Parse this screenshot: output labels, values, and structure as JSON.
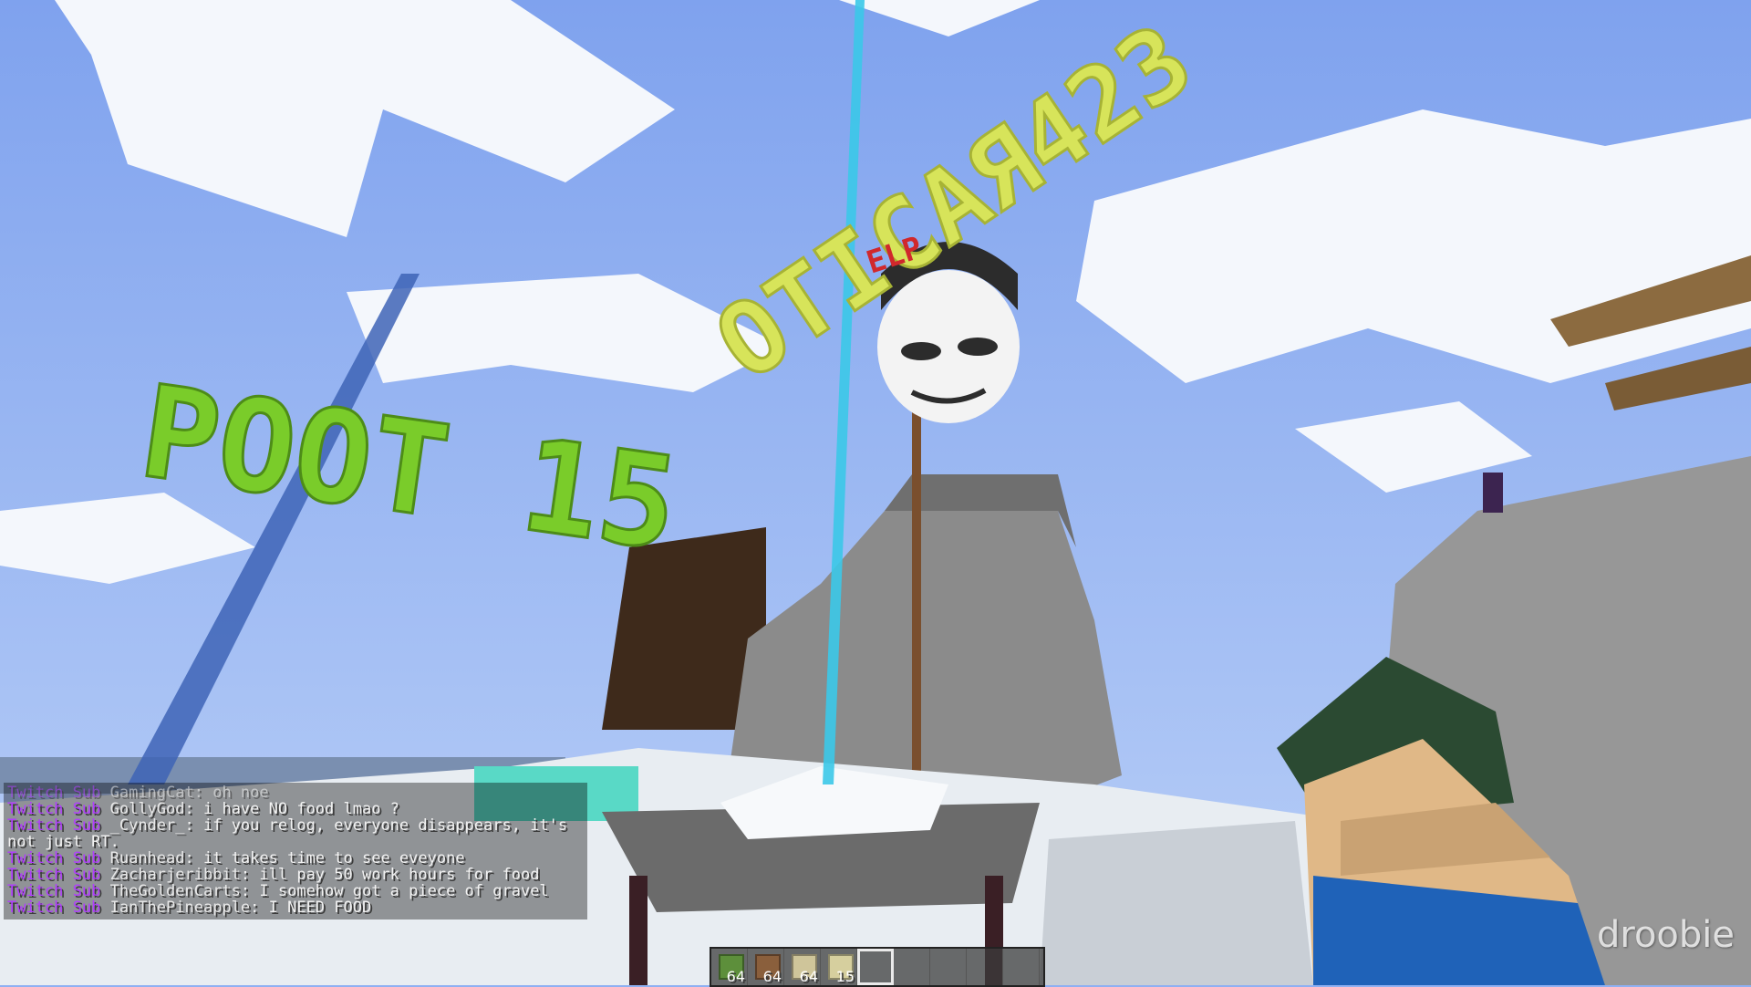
{
  "world": {
    "sign_lower": "POOT 15",
    "sign_upper": "ОТІСАЯ423",
    "sign_badge": "ELP"
  },
  "chat": [
    {
      "tag": "Twitch Sub",
      "user": "GamingCat",
      "msg": "oh noe",
      "faded": true
    },
    {
      "tag": "Twitch Sub",
      "user": "GollyGod",
      "msg": "i have NO food lmao ?"
    },
    {
      "tag": "Twitch Sub",
      "user": "_Cynder_",
      "msg": "if you relog, everyone disappears, it's not just RT."
    },
    {
      "tag": "Twitch Sub",
      "user": "Ruanhead",
      "msg": "it takes time to see eveyone"
    },
    {
      "tag": "Twitch Sub",
      "user": "Zacharjeribbit",
      "msg": "ill pay 50 work hours for food"
    },
    {
      "tag": "Twitch Sub",
      "user": "TheGoldenCarts",
      "msg": "I somehow got a piece of gravel"
    },
    {
      "tag": "Twitch Sub",
      "user": "IanThePineapple",
      "msg": "I NEED FOOD"
    }
  ],
  "hotbar": [
    {
      "item": "grass-block",
      "count": "64",
      "color": "#5d8f3b"
    },
    {
      "item": "dirt-block",
      "count": "64",
      "color": "#8a5f3c"
    },
    {
      "item": "sand-block",
      "count": "64",
      "color": "#cfc59a"
    },
    {
      "item": "sand-block",
      "count": "15",
      "color": "#d6cf9e"
    },
    {
      "item": "empty",
      "count": "",
      "color": ""
    },
    {
      "item": "empty",
      "count": "",
      "color": ""
    },
    {
      "item": "empty",
      "count": "",
      "color": ""
    },
    {
      "item": "empty",
      "count": "",
      "color": ""
    },
    {
      "item": "empty",
      "count": "",
      "color": ""
    }
  ],
  "hotbar_selected": 4,
  "watermark": "droobie"
}
